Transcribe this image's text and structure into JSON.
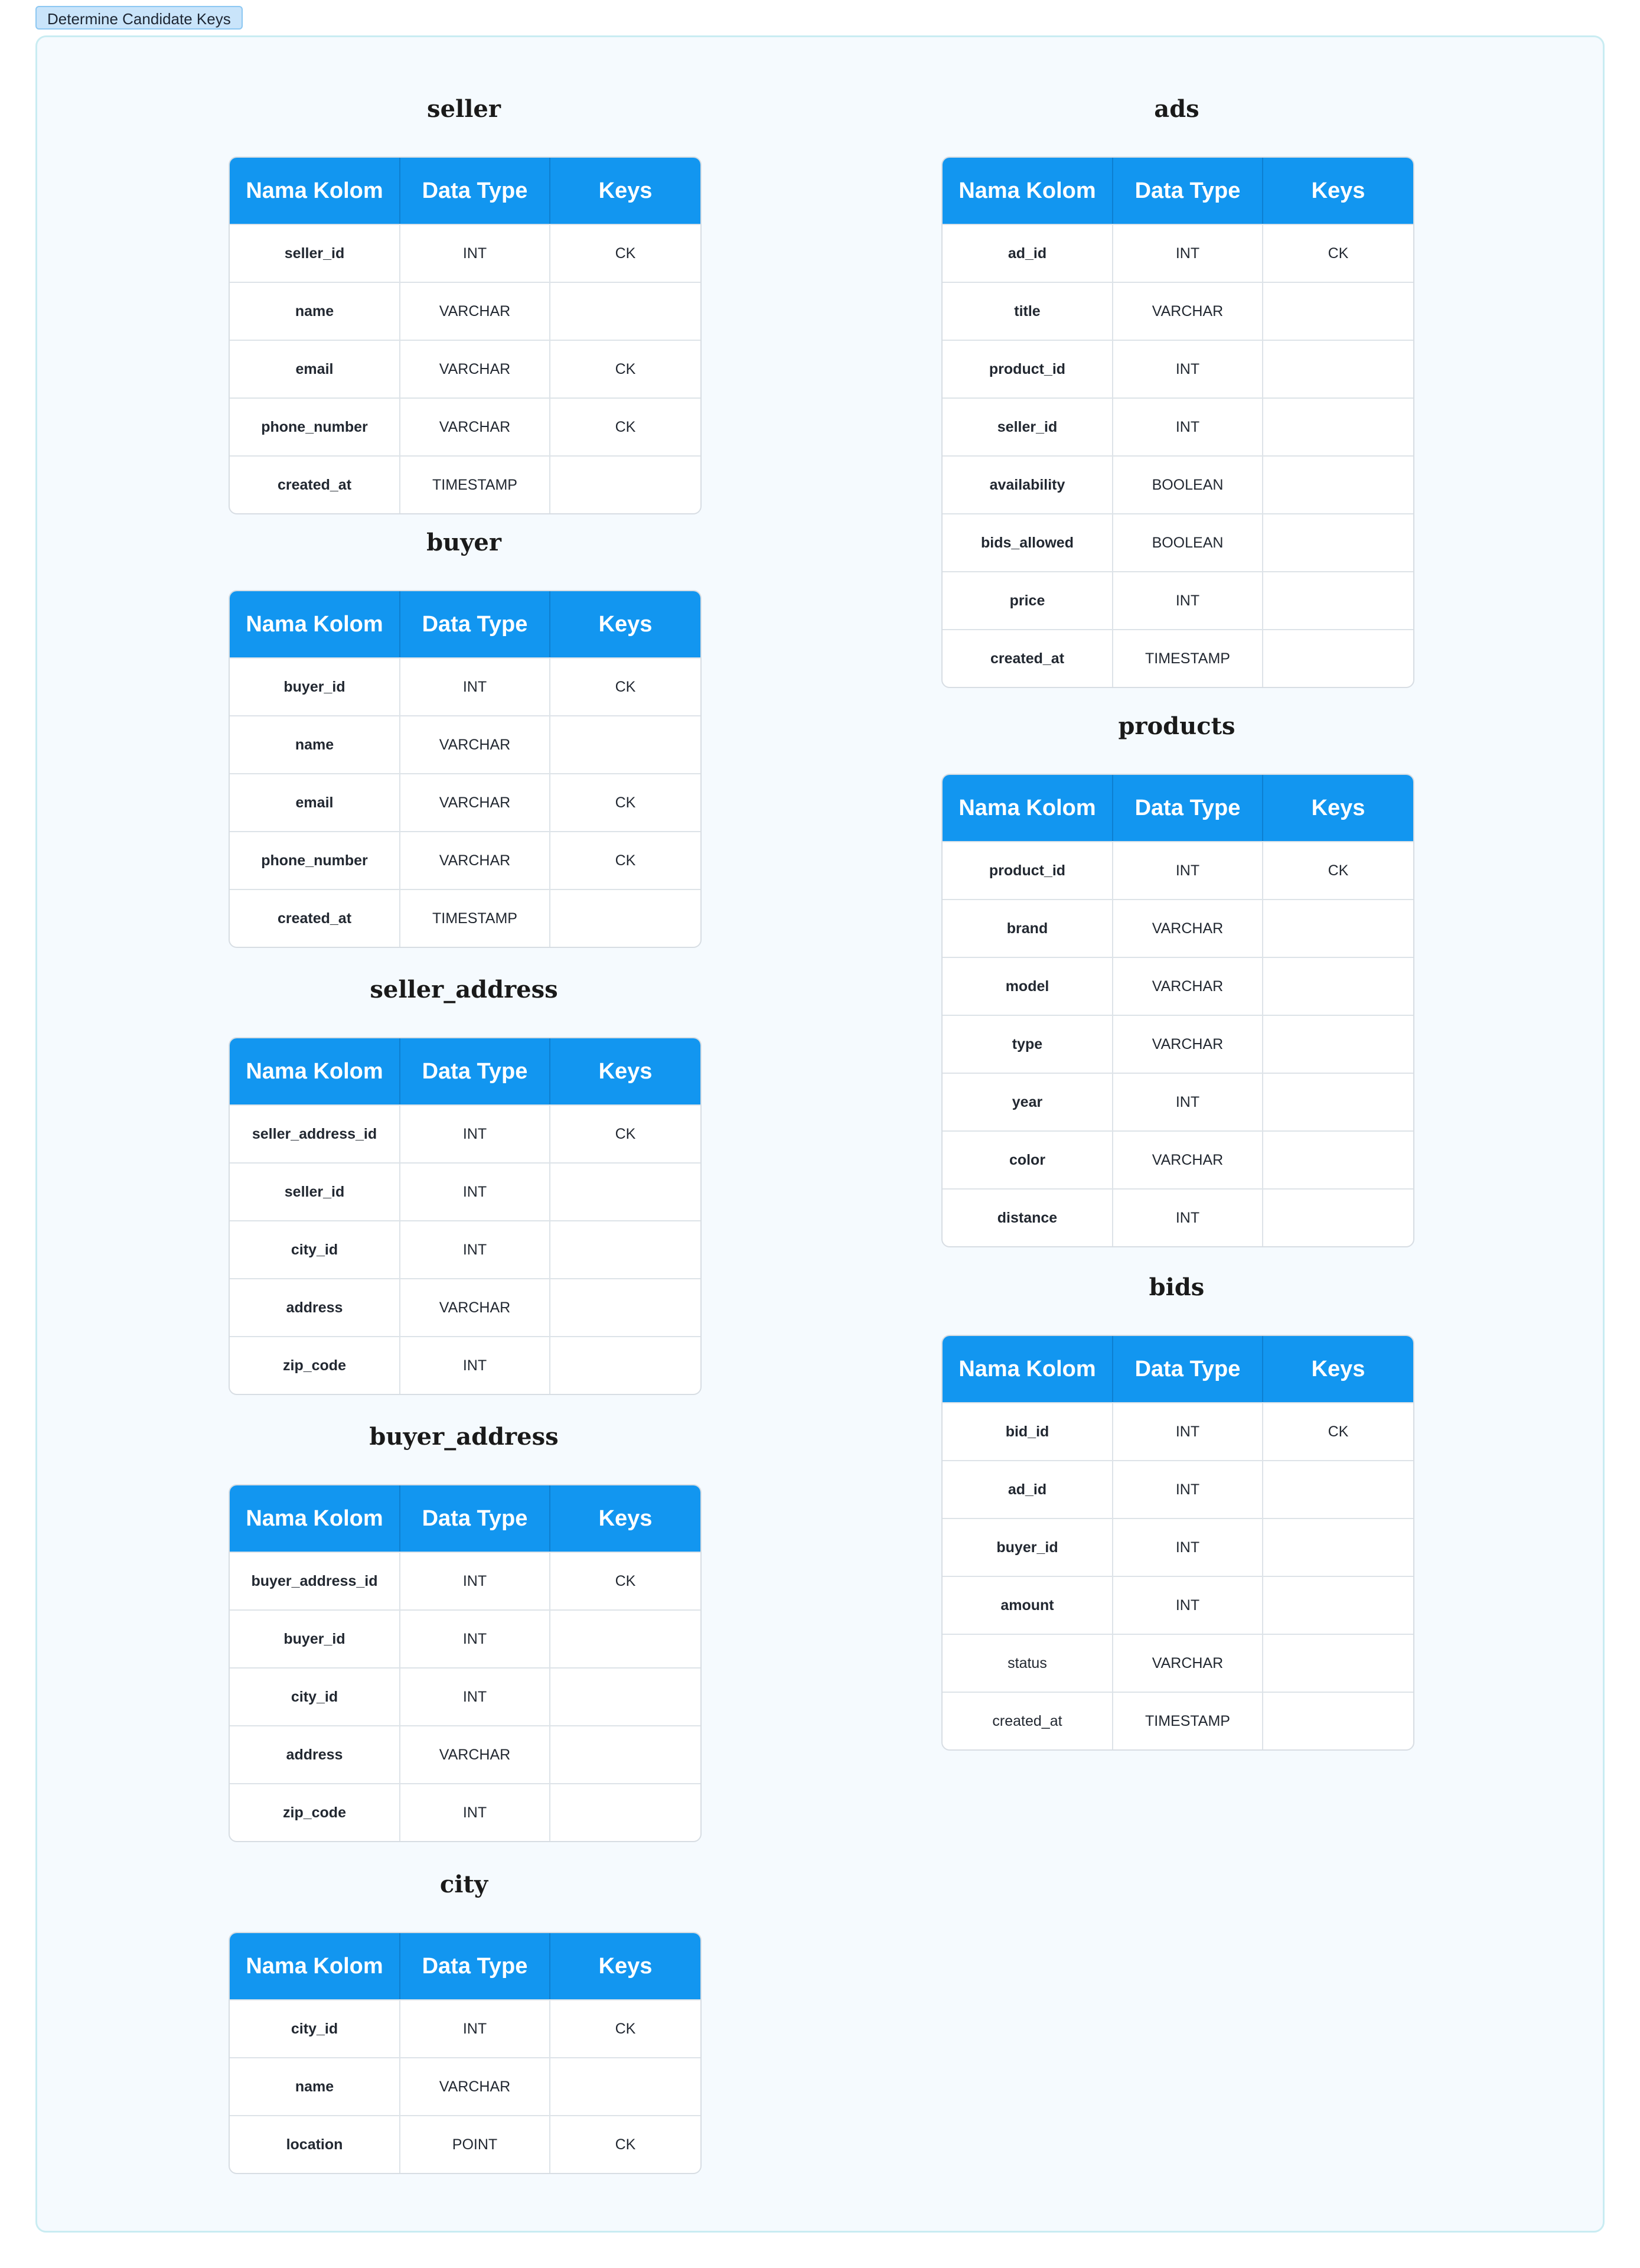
{
  "frame": {
    "label": "Determine Candidate Keys"
  },
  "headers": {
    "col_name": "Nama Kolom",
    "data_type": "Data Type",
    "keys": "Keys"
  },
  "tables": {
    "seller": {
      "title": "seller",
      "rows": [
        {
          "name": "seller_id",
          "type": "INT",
          "key": "CK"
        },
        {
          "name": "name",
          "type": "VARCHAR",
          "key": ""
        },
        {
          "name": "email",
          "type": "VARCHAR",
          "key": "CK"
        },
        {
          "name": "phone_number",
          "type": "VARCHAR",
          "key": "CK"
        },
        {
          "name": "created_at",
          "type": "TIMESTAMP",
          "key": ""
        }
      ]
    },
    "buyer": {
      "title": "buyer",
      "rows": [
        {
          "name": "buyer_id",
          "type": "INT",
          "key": "CK"
        },
        {
          "name": "name",
          "type": "VARCHAR",
          "key": ""
        },
        {
          "name": "email",
          "type": "VARCHAR",
          "key": "CK"
        },
        {
          "name": "phone_number",
          "type": "VARCHAR",
          "key": "CK"
        },
        {
          "name": "created_at",
          "type": "TIMESTAMP",
          "key": ""
        }
      ]
    },
    "seller_address": {
      "title": "seller_address",
      "rows": [
        {
          "name": "seller_address_id",
          "type": "INT",
          "key": "CK"
        },
        {
          "name": "seller_id",
          "type": "INT",
          "key": ""
        },
        {
          "name": "city_id",
          "type": "INT",
          "key": ""
        },
        {
          "name": "address",
          "type": "VARCHAR",
          "key": ""
        },
        {
          "name": "zip_code",
          "type": "INT",
          "key": ""
        }
      ]
    },
    "buyer_address": {
      "title": "buyer_address",
      "rows": [
        {
          "name": "buyer_address_id",
          "type": "INT",
          "key": "CK"
        },
        {
          "name": "buyer_id",
          "type": "INT",
          "key": ""
        },
        {
          "name": "city_id",
          "type": "INT",
          "key": ""
        },
        {
          "name": "address",
          "type": "VARCHAR",
          "key": ""
        },
        {
          "name": "zip_code",
          "type": "INT",
          "key": ""
        }
      ]
    },
    "city": {
      "title": "city",
      "rows": [
        {
          "name": "city_id",
          "type": "INT",
          "key": "CK"
        },
        {
          "name": "name",
          "type": "VARCHAR",
          "key": ""
        },
        {
          "name": "location",
          "type": "POINT",
          "key": "CK"
        }
      ]
    },
    "ads": {
      "title": "ads",
      "rows": [
        {
          "name": "ad_id",
          "type": "INT",
          "key": "CK"
        },
        {
          "name": "title",
          "type": "VARCHAR",
          "key": ""
        },
        {
          "name": "product_id",
          "type": "INT",
          "key": ""
        },
        {
          "name": "seller_id",
          "type": "INT",
          "key": ""
        },
        {
          "name": "availability",
          "type": "BOOLEAN",
          "key": ""
        },
        {
          "name": "bids_allowed",
          "type": "BOOLEAN",
          "key": ""
        },
        {
          "name": "price",
          "type": "INT",
          "key": ""
        },
        {
          "name": "created_at",
          "type": "TIMESTAMP",
          "key": ""
        }
      ]
    },
    "products": {
      "title": "products",
      "rows": [
        {
          "name": "product_id",
          "type": "INT",
          "key": "CK"
        },
        {
          "name": "brand",
          "type": "VARCHAR",
          "key": ""
        },
        {
          "name": "model",
          "type": "VARCHAR",
          "key": ""
        },
        {
          "name": "type",
          "type": "VARCHAR",
          "key": ""
        },
        {
          "name": "year",
          "type": "INT",
          "key": ""
        },
        {
          "name": "color",
          "type": "VARCHAR",
          "key": ""
        },
        {
          "name": "distance",
          "type": "INT",
          "key": ""
        }
      ]
    },
    "bids": {
      "title": "bids",
      "rows": [
        {
          "name": "bid_id",
          "type": "INT",
          "key": "CK"
        },
        {
          "name": "ad_id",
          "type": "INT",
          "key": ""
        },
        {
          "name": "buyer_id",
          "type": "INT",
          "key": ""
        },
        {
          "name": "amount",
          "type": "INT",
          "key": ""
        },
        {
          "name": "status",
          "type": "VARCHAR",
          "key": ""
        },
        {
          "name": "created_at",
          "type": "TIMESTAMP",
          "key": ""
        }
      ]
    }
  }
}
